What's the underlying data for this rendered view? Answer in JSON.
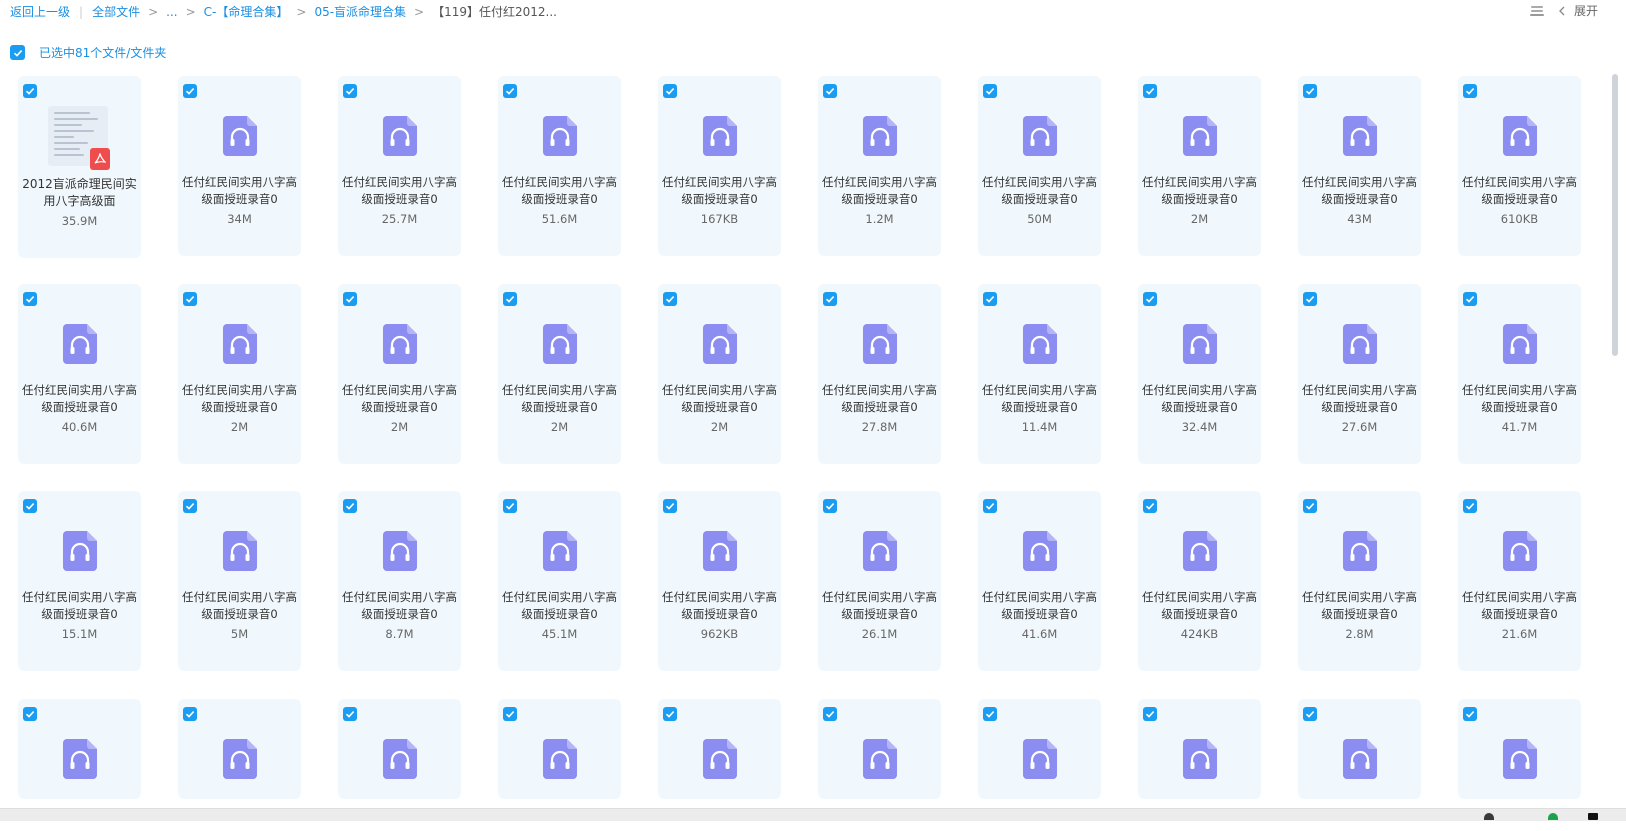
{
  "breadcrumb": {
    "back": "返回上一级",
    "all_files": "全部文件",
    "ellipsis": "...",
    "folder_1": "C-【命理合集】",
    "folder_2": "05-盲派命理合集",
    "current": "【119】任付红2012...",
    "separator": ">",
    "divider": "|"
  },
  "toolbar": {
    "expand_label": "展开",
    "list_view_icon": "list-view-icon",
    "collapse_icon": "chevron-left-icon"
  },
  "selection": {
    "label": "已选中81个文件/文件夹",
    "checked": true
  },
  "files": [
    {
      "name": "2012盲派命理民间实用八字高级面",
      "size": "35.9M",
      "type": "pdf"
    },
    {
      "name": "任付红民间实用八字高级面授班录音0",
      "size": "34M",
      "type": "audio"
    },
    {
      "name": "任付红民间实用八字高级面授班录音0",
      "size": "25.7M",
      "type": "audio"
    },
    {
      "name": "任付红民间实用八字高级面授班录音0",
      "size": "51.6M",
      "type": "audio"
    },
    {
      "name": "任付红民间实用八字高级面授班录音0",
      "size": "167KB",
      "type": "audio"
    },
    {
      "name": "任付红民间实用八字高级面授班录音0",
      "size": "1.2M",
      "type": "audio"
    },
    {
      "name": "任付红民间实用八字高级面授班录音0",
      "size": "50M",
      "type": "audio"
    },
    {
      "name": "任付红民间实用八字高级面授班录音0",
      "size": "2M",
      "type": "audio"
    },
    {
      "name": "任付红民间实用八字高级面授班录音0",
      "size": "43M",
      "type": "audio"
    },
    {
      "name": "任付红民间实用八字高级面授班录音0",
      "size": "610KB",
      "type": "audio"
    },
    {
      "name": "任付红民间实用八字高级面授班录音0",
      "size": "40.6M",
      "type": "audio"
    },
    {
      "name": "任付红民间实用八字高级面授班录音0",
      "size": "2M",
      "type": "audio"
    },
    {
      "name": "任付红民间实用八字高级面授班录音0",
      "size": "2M",
      "type": "audio"
    },
    {
      "name": "任付红民间实用八字高级面授班录音0",
      "size": "2M",
      "type": "audio"
    },
    {
      "name": "任付红民间实用八字高级面授班录音0",
      "size": "2M",
      "type": "audio"
    },
    {
      "name": "任付红民间实用八字高级面授班录音0",
      "size": "27.8M",
      "type": "audio"
    },
    {
      "name": "任付红民间实用八字高级面授班录音0",
      "size": "11.4M",
      "type": "audio"
    },
    {
      "name": "任付红民间实用八字高级面授班录音0",
      "size": "32.4M",
      "type": "audio"
    },
    {
      "name": "任付红民间实用八字高级面授班录音0",
      "size": "27.6M",
      "type": "audio"
    },
    {
      "name": "任付红民间实用八字高级面授班录音0",
      "size": "41.7M",
      "type": "audio"
    },
    {
      "name": "任付红民间实用八字高级面授班录音0",
      "size": "15.1M",
      "type": "audio"
    },
    {
      "name": "任付红民间实用八字高级面授班录音0",
      "size": "5M",
      "type": "audio"
    },
    {
      "name": "任付红民间实用八字高级面授班录音0",
      "size": "8.7M",
      "type": "audio"
    },
    {
      "name": "任付红民间实用八字高级面授班录音0",
      "size": "45.1M",
      "type": "audio"
    },
    {
      "name": "任付红民间实用八字高级面授班录音0",
      "size": "962KB",
      "type": "audio"
    },
    {
      "name": "任付红民间实用八字高级面授班录音0",
      "size": "26.1M",
      "type": "audio"
    },
    {
      "name": "任付红民间实用八字高级面授班录音0",
      "size": "41.6M",
      "type": "audio"
    },
    {
      "name": "任付红民间实用八字高级面授班录音0",
      "size": "424KB",
      "type": "audio"
    },
    {
      "name": "任付红民间实用八字高级面授班录音0",
      "size": "2.8M",
      "type": "audio"
    },
    {
      "name": "任付红民间实用八字高级面授班录音0",
      "size": "21.6M",
      "type": "audio"
    },
    {
      "name": "",
      "size": "",
      "type": "audio"
    },
    {
      "name": "",
      "size": "",
      "type": "audio"
    },
    {
      "name": "",
      "size": "",
      "type": "audio"
    },
    {
      "name": "",
      "size": "",
      "type": "audio"
    },
    {
      "name": "",
      "size": "",
      "type": "audio"
    },
    {
      "name": "",
      "size": "",
      "type": "audio"
    },
    {
      "name": "",
      "size": "",
      "type": "audio"
    },
    {
      "name": "",
      "size": "",
      "type": "audio"
    },
    {
      "name": "",
      "size": "",
      "type": "audio"
    },
    {
      "name": "",
      "size": "",
      "type": "audio"
    }
  ],
  "colors": {
    "accent": "#1a9cf0",
    "link": "#1a8fe3",
    "tile_bg": "#f1f8fd",
    "audio_icon": "#8b8df0",
    "pdf_badge": "#ef4d4d"
  }
}
